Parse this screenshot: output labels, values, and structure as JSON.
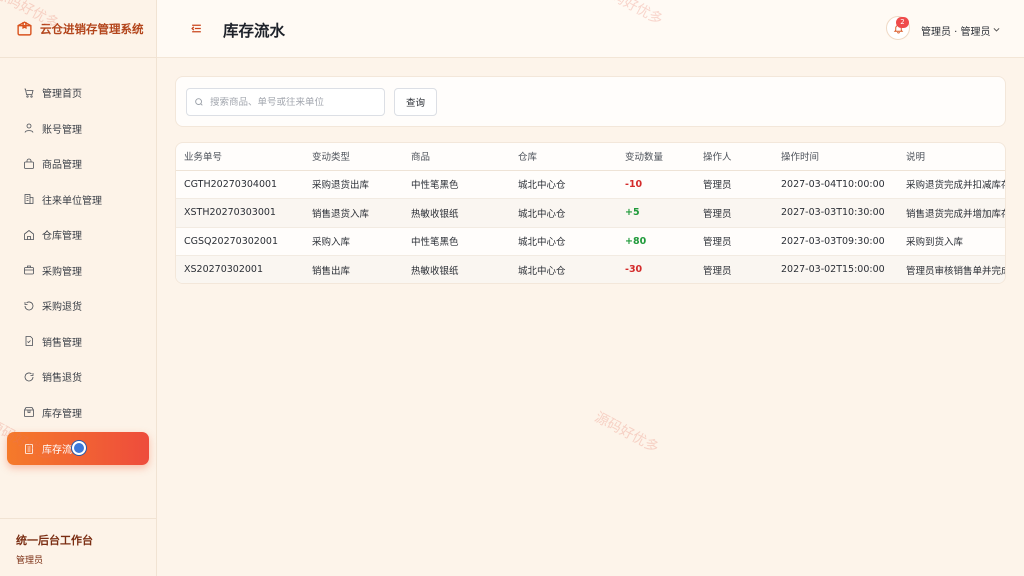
{
  "app": {
    "title": "云仓进销存管理系统"
  },
  "sidebar": {
    "items": [
      {
        "label": "管理首页",
        "icon": "home-cart-icon"
      },
      {
        "label": "账号管理",
        "icon": "user-icon"
      },
      {
        "label": "商品管理",
        "icon": "bag-icon"
      },
      {
        "label": "往来单位管理",
        "icon": "building-icon"
      },
      {
        "label": "仓库管理",
        "icon": "warehouse-icon"
      },
      {
        "label": "采购管理",
        "icon": "briefcase-icon"
      },
      {
        "label": "采购退货",
        "icon": "undo-icon"
      },
      {
        "label": "销售管理",
        "icon": "document-check-icon"
      },
      {
        "label": "销售退货",
        "icon": "refresh-icon"
      },
      {
        "label": "库存管理",
        "icon": "box-icon"
      },
      {
        "label": "库存流水",
        "icon": "ledger-icon",
        "active": true
      }
    ],
    "footer": {
      "workspace": "统一后台工作台",
      "role": "管理员"
    }
  },
  "header": {
    "page_title": "库存流水",
    "notification_count": "2",
    "user": "管理员 · 管理员"
  },
  "search": {
    "placeholder": "搜索商品、单号或往来单位",
    "value": "",
    "button_label": "查询"
  },
  "table": {
    "columns": [
      "业务单号",
      "变动类型",
      "商品",
      "仓库",
      "变动数量",
      "操作人",
      "操作时间",
      "说明"
    ],
    "rows": [
      {
        "order_no": "CGTH20270304001",
        "type": "采购退货出库",
        "product": "中性笔黑色",
        "warehouse": "城北中心仓",
        "qty": "-10",
        "operator": "管理员",
        "time": "2027-03-04T10:00:00",
        "note": "采购退货完成并扣减库存"
      },
      {
        "order_no": "XSTH20270303001",
        "type": "销售退货入库",
        "product": "热敏收银纸",
        "warehouse": "城北中心仓",
        "qty": "+5",
        "operator": "管理员",
        "time": "2027-03-03T10:30:00",
        "note": "销售退货完成并增加库存"
      },
      {
        "order_no": "CGSQ20270302001",
        "type": "采购入库",
        "product": "中性笔黑色",
        "warehouse": "城北中心仓",
        "qty": "+80",
        "operator": "管理员",
        "time": "2027-03-03T09:30:00",
        "note": "采购到货入库"
      },
      {
        "order_no": "XS20270302001",
        "type": "销售出库",
        "product": "热敏收银纸",
        "warehouse": "城北中心仓",
        "qty": "-30",
        "operator": "管理员",
        "time": "2027-03-02T15:00:00",
        "note": "管理员审核销售单并完成出库"
      }
    ]
  },
  "watermark": "源码好优多",
  "colors": {
    "accent": "#f26a30",
    "brand_text": "#b3451c",
    "negative": "#d42b2b",
    "positive": "#1f9a3a"
  }
}
